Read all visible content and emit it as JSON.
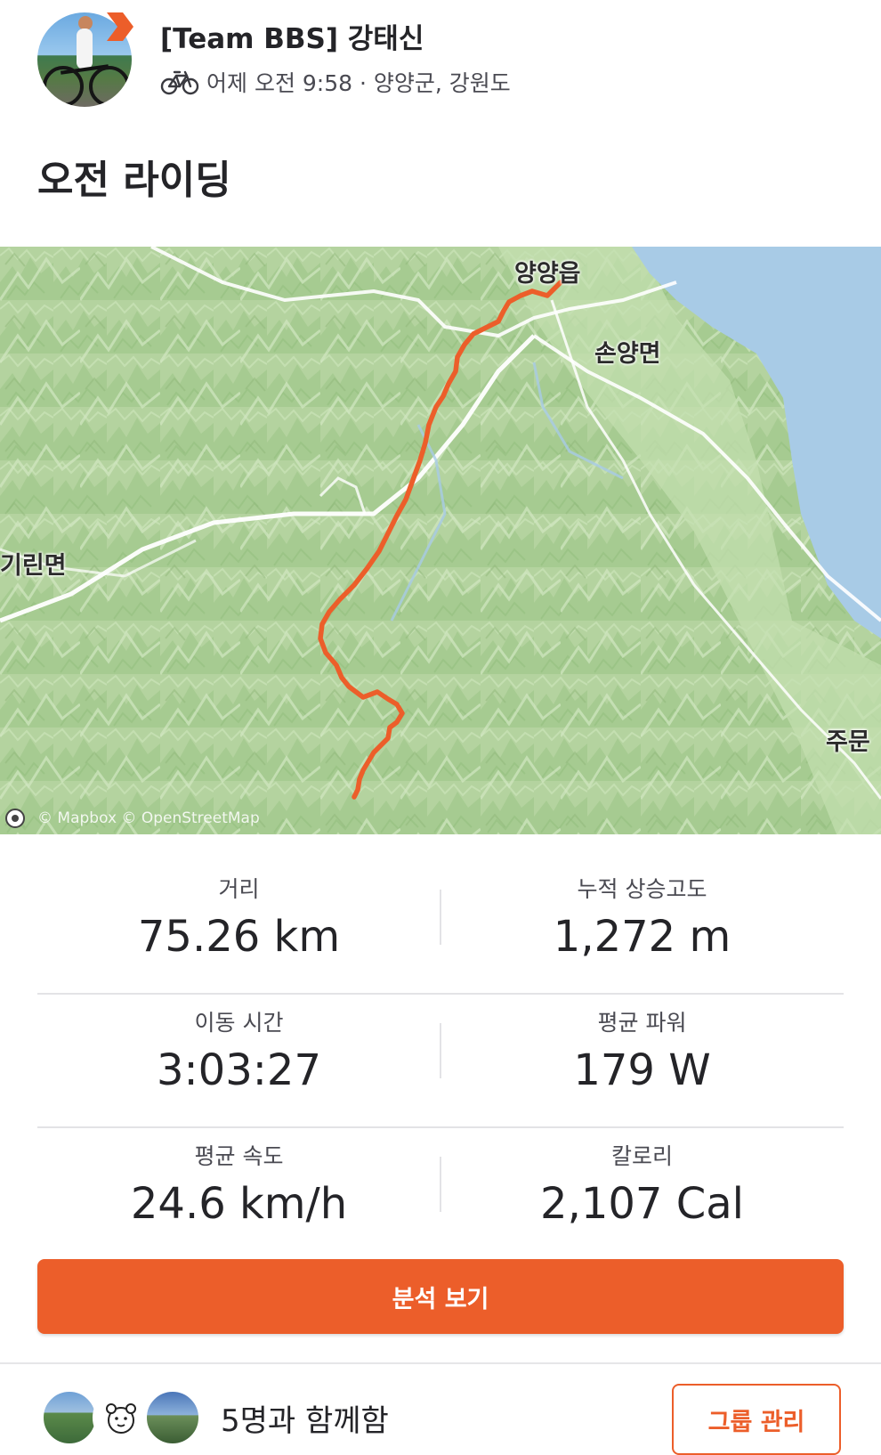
{
  "header": {
    "athlete_name": "[Team BBS] 강태신",
    "meta_text": "어제 오전 9:58 · 양양군, 강원도",
    "activity_icon": "bike-icon"
  },
  "activity": {
    "title": "오전 라이딩"
  },
  "map": {
    "labels": {
      "town_1": "양양읍",
      "town_2": "손양면",
      "town_3": "기린면",
      "town_4": "주문"
    },
    "attribution": "© Mapbox © OpenStreetMap",
    "route_color": "#ec5e2a",
    "water_color": "#a8cbe6",
    "land_color": "#b9d6a6"
  },
  "stats": {
    "distance": {
      "label": "거리",
      "value": "75.26 km"
    },
    "elevation": {
      "label": "누적 상승고도",
      "value": "1,272 m"
    },
    "moving_time": {
      "label": "이동 시간",
      "value": "3:03:27"
    },
    "avg_power": {
      "label": "평균 파워",
      "value": "179 W"
    },
    "avg_speed": {
      "label": "평균 속도",
      "value": "24.6 km/h"
    },
    "calories": {
      "label": "칼로리",
      "value": "2,107 Cal"
    }
  },
  "actions": {
    "analyze_label": "분석 보기",
    "group_text": "5명과 함께함",
    "group_manage_label": "그룹 관리"
  },
  "colors": {
    "accent": "#ec5e2a",
    "text": "#242428",
    "muted": "#4a4a52"
  }
}
